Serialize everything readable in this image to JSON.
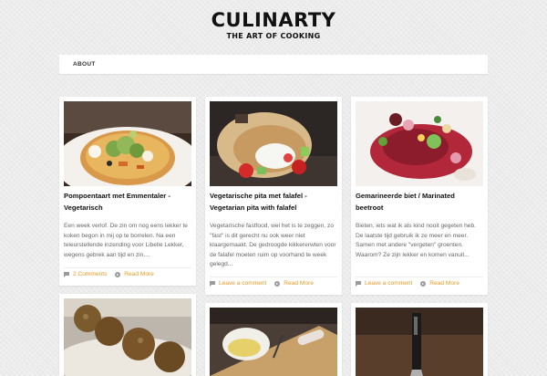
{
  "site": {
    "title": "CULINARTY",
    "tagline": "THE ART OF COOKING"
  },
  "nav": {
    "items": [
      {
        "label": "ABOUT"
      }
    ]
  },
  "colors": {
    "accent": "#e59b2a",
    "meta_icon": "#9a9a9a",
    "background": "#ececec"
  },
  "posts": [
    {
      "title": "Pompoentaart met Emmentaler - Vegetarisch",
      "excerpt": "Een week verlof. De zin om nog eens lekker te koken begon in mij op te borrelen. Na een teleurstellende inzending voor Libelle Lekker, wegens gebrek aan tijd en zin,...",
      "comments_label": "2 Comments",
      "comments_icon": "speech-bubble-icon",
      "read_more_label": "Read More",
      "read_more_icon": "circle-arrow-icon"
    },
    {
      "title": "Vegetarische pita met falafel - Vegetarian pita with falafel",
      "excerpt": "Vegetarische fastfood, wel het is te zeggen, zo \"fast\" is dit gerecht nu ook weer niet klaargemaakt. De gedroogde kikkererwten voor de falafel moeten ruim op voorhand te week gelegd...",
      "comments_label": "Leave a comment",
      "comments_icon": "speech-bubble-icon",
      "read_more_label": "Read More",
      "read_more_icon": "circle-arrow-icon"
    },
    {
      "title": "Gemarineerde biet / Marinated beetroot",
      "excerpt": "Bieten, iets wat ik als kind nooit gegeten heb. De laatste tijd gebruik ik ze meer en meer. Samen met andere \"vergeten\" groenten. Waarom? Ze zijn lekker en komen vanuit...",
      "comments_label": "Leave a comment",
      "comments_icon": "speech-bubble-icon",
      "read_more_label": "Read More",
      "read_more_icon": "circle-arrow-icon"
    },
    {
      "image": "falafel-balls-photo"
    },
    {
      "image": "food-prep-photo"
    },
    {
      "image": "knife-photo"
    }
  ]
}
